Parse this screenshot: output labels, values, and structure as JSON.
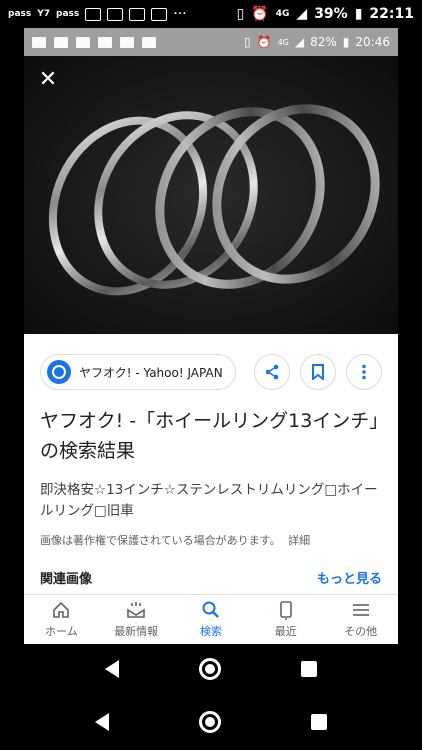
{
  "outer_status": {
    "left_icons": [
      "pass-icon",
      "yahoo-icon",
      "pass-icon",
      "mail-icon",
      "mail-icon",
      "mail-icon",
      "mail-icon",
      "more-dots-icon"
    ],
    "left_labels": [
      "pass",
      "Y7",
      "pass",
      "",
      "",
      "",
      ""
    ],
    "more": "···",
    "battery": "39%",
    "time": "22:11",
    "network": "4G"
  },
  "inner_status": {
    "battery": "82%",
    "time": "20:46",
    "network": "4G"
  },
  "image": {
    "close_label": "✕"
  },
  "result": {
    "source": "ヤフオク! - Yahoo! JAPAN",
    "title": "ヤフオク! -「ホイールリング13インチ」の検索結果",
    "description": "即決格安☆13インチ☆ステンレストリムリング□ホイールリング□旧車",
    "copyright": "画像は著作権で保護されている場合があります。",
    "detail_link": "詳細",
    "related_label": "関連画像",
    "more_link": "もっと見る"
  },
  "bottom_nav": [
    {
      "label": "ホーム",
      "icon": "home-icon",
      "active": false
    },
    {
      "label": "最新情報",
      "icon": "news-icon",
      "active": false
    },
    {
      "label": "検索",
      "icon": "search-icon",
      "active": true
    },
    {
      "label": "最近",
      "icon": "recent-icon",
      "active": false
    },
    {
      "label": "その他",
      "icon": "menu-icon",
      "active": false
    }
  ],
  "colors": {
    "accent": "#1a73e8",
    "text": "#202124"
  }
}
